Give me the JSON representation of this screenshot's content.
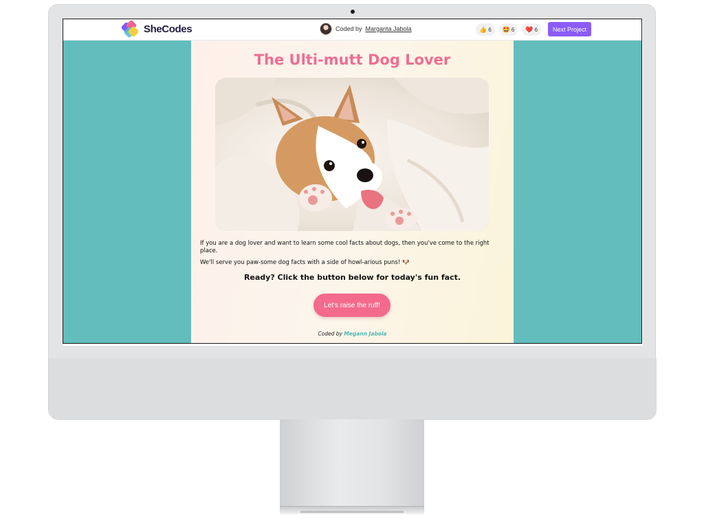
{
  "header": {
    "logo_text": "SheCodes",
    "coded_by_label": "Coded by",
    "coder_name": "Margarita Jabola",
    "reactions": [
      {
        "icon": "thumbs-up-icon",
        "emoji": "👍",
        "count": "6"
      },
      {
        "icon": "star-struck-icon",
        "emoji": "🤩",
        "count": "6"
      },
      {
        "icon": "heart-icon",
        "emoji": "❤️",
        "count": "6"
      }
    ],
    "next_button": "Next Project"
  },
  "page": {
    "title": "The Ulti-mutt Dog Lover",
    "hero_alt": "",
    "paragraph_1": "If you are a dog lover and want to learn some cool facts about dogs, then you've come to the right place.",
    "paragraph_2": "We'll serve you paw-some dog facts with a side of howl-arious puns! 🐶",
    "ready_text": "Ready? Click the button below for today's fun fact.",
    "cta_button": "Let's raise the ruff!",
    "footer_label": "Coded by",
    "footer_name": "Megann Jabola"
  },
  "colors": {
    "background": "#63bdbd",
    "title": "#ef6d92",
    "cta": "#f36a8d",
    "next_button": "#8b5cf6",
    "footer_name": "#4fb7b5"
  }
}
